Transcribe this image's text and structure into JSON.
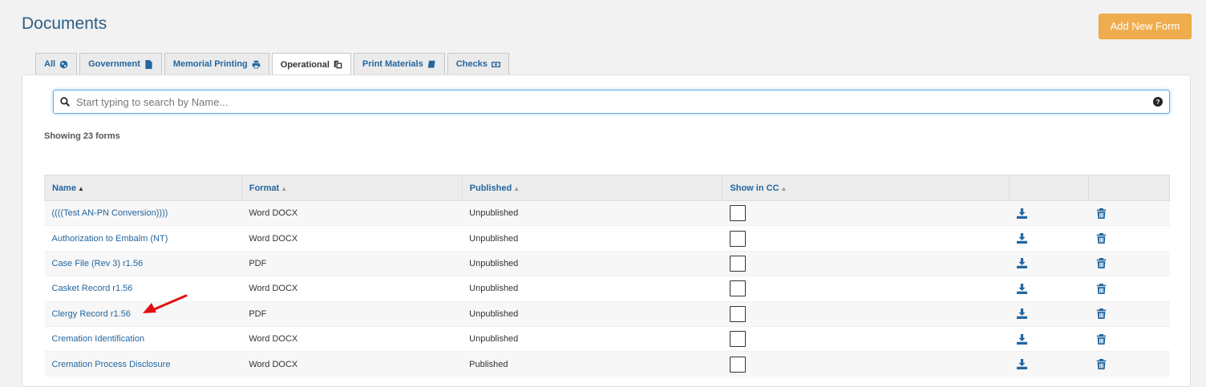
{
  "page": {
    "title": "Documents",
    "add_button": "Add New Form",
    "accent": "#2366a0",
    "button_color": "#f0ad4e"
  },
  "tabs": [
    {
      "label": "All",
      "icon": "globe-icon"
    },
    {
      "label": "Government",
      "icon": "file-icon"
    },
    {
      "label": "Memorial Printing",
      "icon": "print-icon"
    },
    {
      "label": "Operational",
      "icon": "copy-icon",
      "active": true
    },
    {
      "label": "Print Materials",
      "icon": "book-icon"
    },
    {
      "label": "Checks",
      "icon": "money-icon"
    }
  ],
  "search": {
    "placeholder": "Start typing to search by Name..."
  },
  "showing": "Showing 23 forms",
  "table": {
    "columns": [
      "Name",
      "Format",
      "Published",
      "Show in CC"
    ],
    "rows": [
      {
        "name": "((((Test AN-PN Conversion))))",
        "format": "Word DOCX",
        "published": "Unpublished",
        "show_in_cc": false
      },
      {
        "name": "Authorization to Embalm (NT)",
        "format": "Word DOCX",
        "published": "Unpublished",
        "show_in_cc": false
      },
      {
        "name": "Case File (Rev 3) r1.56",
        "format": "PDF",
        "published": "Unpublished",
        "show_in_cc": false
      },
      {
        "name": "Casket Record r1.56",
        "format": "Word DOCX",
        "published": "Unpublished",
        "show_in_cc": false
      },
      {
        "name": "Clergy Record r1.56",
        "format": "PDF",
        "published": "Unpublished",
        "show_in_cc": false
      },
      {
        "name": "Cremation Identification",
        "format": "Word DOCX",
        "published": "Unpublished",
        "show_in_cc": false
      },
      {
        "name": "Cremation Process Disclosure",
        "format": "Word DOCX",
        "published": "Published",
        "show_in_cc": false
      }
    ]
  }
}
